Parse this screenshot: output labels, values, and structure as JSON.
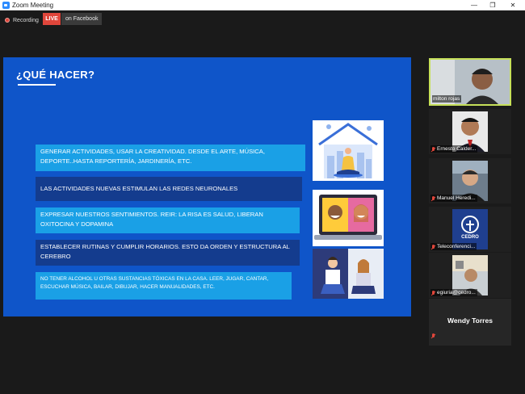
{
  "window": {
    "title": "Zoom Meeting",
    "minimize_glyph": "—",
    "maximize_glyph": "❐",
    "close_glyph": "✕"
  },
  "status": {
    "recording_label": "Recording",
    "live_label": "LIVE",
    "stream_target": "on Facebook"
  },
  "slide": {
    "title": "¿QUÉ HACER?",
    "bullets": [
      "GENERAR ACTIVIDADES, USAR LA CREATIVIDAD. DESDE EL ARTE, MÚSICA, DEPORTE..HASTA REPORTERÍA, JARDINERÍA, ETC.",
      "LAS ACTIVIDADES NUEVAS ESTIMULAN LAS REDES NEURONALES",
      "EXPRESAR NUESTROS SENTIMIENTOS. REIR: LA RISA ES SALUD, LIBERAN OXITOCINA Y DOPAMINA",
      "ESTABLECER RUTINAS Y CUMPLIR HORARIOS. ESTO DA ORDEN Y ESTRUCTURA AL CEREBRO",
      "NO TENER ALCOHOL U OTRAS SUSTANCIAS TÓXICAS EN LA CASA. LEER, JUGAR, CANTAR, ESCUCHAR MÚSICA, BAILAR, DIBUJAR, HACER MANUALIDADES, ETC."
    ]
  },
  "participants": [
    {
      "name": "milton rojas",
      "active_speaker": true,
      "muted": false
    },
    {
      "name": "Ernesto Calder...",
      "muted": true
    },
    {
      "name": "Manuel Heredi...",
      "muted": true
    },
    {
      "name": "Teleconferenci...",
      "muted": true,
      "logo_text": "CEDRO"
    },
    {
      "name": "egiuria@cedro...",
      "muted": true
    },
    {
      "name": "Wendy Torres",
      "muted": true,
      "video_off": true
    }
  ],
  "colors": {
    "slide_bg": "#0f55c9",
    "bullet_light": "#1aa0e6",
    "bullet_dark": "#143c8e",
    "active_speaker_border": "#c6e05a",
    "live_red": "#e0463b"
  }
}
